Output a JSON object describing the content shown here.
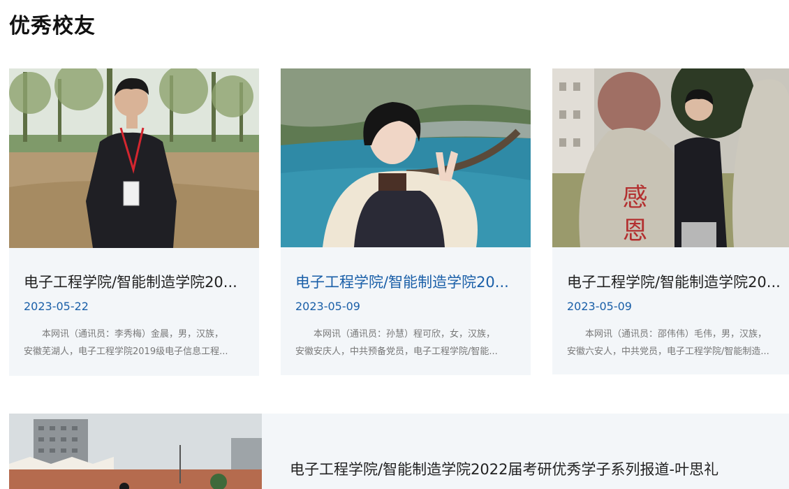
{
  "section": {
    "title": "优秀校友"
  },
  "cards": [
    {
      "title": "电子工程学院/智能制造学院20...",
      "date": "2023-05-22",
      "summary_line1": "本网讯（通讯员：李秀梅）金晨，男，汉族，",
      "summary_line2": "安徽芜湖人，电子工程学院2019级电子信息工程..."
    },
    {
      "title": "电子工程学院/智能制造学院20...",
      "date": "2023-05-09",
      "summary_line1": "本网讯（通讯员：孙慧）程可欣，女，汉族，",
      "summary_line2": "安徽安庆人，中共预备党员，电子工程学院/智能..."
    },
    {
      "title": "电子工程学院/智能制造学院20...",
      "date": "2023-05-09",
      "summary_line1": "本网讯（通讯员：邵伟伟）毛伟，男，汉族，",
      "summary_line2": "安徽六安人，中共党员，电子工程学院/智能制造..."
    }
  ],
  "featured": {
    "title": "电子工程学院/智能制造学院2022届考研优秀学子系列报道-叶思礼"
  },
  "photo_text": {
    "stone_text": "感 恩"
  },
  "colors": {
    "accent": "#1a5fa8",
    "card_bg": "#f3f6f9",
    "title": "#222222",
    "summary": "#777777"
  }
}
